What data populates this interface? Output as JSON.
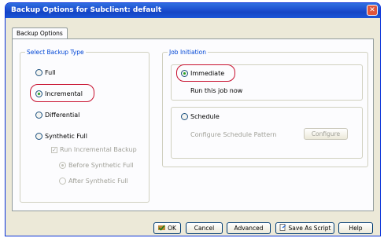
{
  "window": {
    "title": "Backup Options for Subclient: default",
    "close_glyph": "✕"
  },
  "tabs": [
    {
      "label": "Backup Options"
    }
  ],
  "backup_type": {
    "legend": "Select Backup Type",
    "options": [
      {
        "label": "Full",
        "selected": false
      },
      {
        "label": "Incremental",
        "selected": true
      },
      {
        "label": "Differential",
        "selected": false
      },
      {
        "label": "Synthetic Full",
        "selected": false
      }
    ],
    "run_incremental": {
      "label": "Run Incremental Backup",
      "checked": true,
      "enabled": false
    },
    "sub_options": [
      {
        "label": "Before Synthetic Full",
        "selected": true,
        "enabled": false
      },
      {
        "label": "After Synthetic Full",
        "selected": false,
        "enabled": false
      }
    ]
  },
  "job_initiation": {
    "legend": "Job Initiation",
    "immediate": {
      "label": "Immediate",
      "selected": true,
      "description": "Run this job now"
    },
    "schedule": {
      "label": "Schedule",
      "selected": false,
      "configure_text": "Configure Schedule Pattern",
      "configure_button": "Configure"
    }
  },
  "buttons": {
    "ok": "OK",
    "cancel": "Cancel",
    "advanced": "Advanced",
    "save_script": "Save As Script",
    "help": "Help"
  },
  "icons": {
    "ok": "ok-check-icon",
    "save_script": "script-icon",
    "close": "close-icon"
  },
  "colors": {
    "title_bar": "#1d4fd0",
    "highlight": "#c8102e",
    "legend": "#0046d5"
  }
}
